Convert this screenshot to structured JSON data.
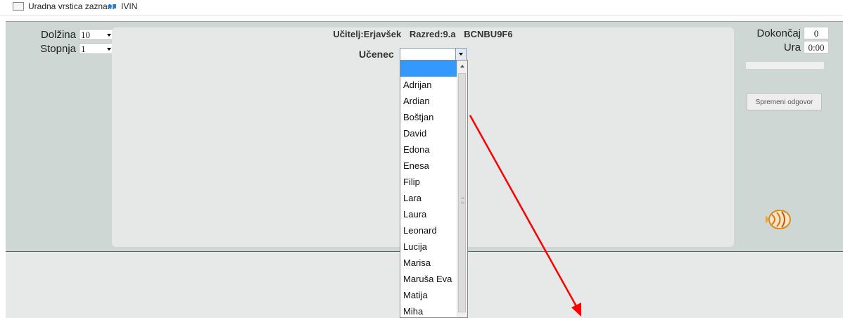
{
  "bookmarks": [
    {
      "label": "Uradna vrstica zazna...",
      "icon": "document-icon"
    },
    {
      "label": "IVIN",
      "icon": "ivin-logo-icon"
    }
  ],
  "settings": {
    "length_label": "Dolžina",
    "length_value": "10",
    "level_label": "Stopnja",
    "level_value": "1"
  },
  "header": {
    "teacher": "Učitelj:Erjavšek",
    "class": "Razred:9.a",
    "code": "BCNBU9F6"
  },
  "student": {
    "label": "Učenec",
    "selected": "",
    "options": [
      "",
      "Adrijan",
      "Ardian",
      "Boštjan",
      "David",
      "Edona",
      "Enesa",
      "Filip",
      "Lara",
      "Laura",
      "Leonard",
      "Lucija",
      "Marisa",
      "Maruša Eva",
      "Matija",
      "Miha"
    ]
  },
  "status": {
    "finish_label": "Dokončaj",
    "finish_value": "0",
    "time_label": "Ura",
    "time_value": "0:00",
    "progress": 0
  },
  "change_answer_label": "Spremeni odgovor",
  "colors": {
    "selection": "#3399ff",
    "annotation_arrow": "#ff0000",
    "panel_bg": "#cfd7d5",
    "center_bg": "#e6e8e7"
  }
}
